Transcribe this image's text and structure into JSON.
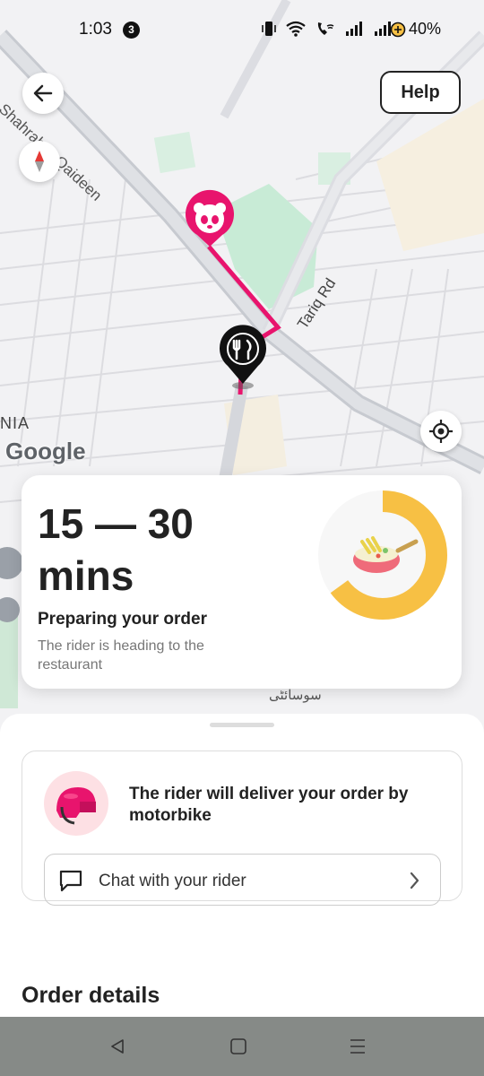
{
  "status_bar": {
    "time": "1:03",
    "notification_count": "3",
    "battery": "40%"
  },
  "map": {
    "street_1": "Shahrah-e-Qaideen",
    "street_2": "Tariq Rd",
    "area_label": "NIA",
    "urdu_label": "سوسائٹی",
    "google_logo": "Google",
    "route_color": "#e8146d",
    "restaurant_pin_color": "#111111"
  },
  "buttons": {
    "help_label": "Help"
  },
  "eta": {
    "range": "15 — 30",
    "unit": "mins",
    "status": "Preparing your order",
    "sub": "The rider is heading to the restaurant",
    "progress_color": "#f7c044"
  },
  "rider": {
    "message": "The rider will deliver your order by motorbike",
    "chat_label": "Chat with your rider"
  },
  "order": {
    "title": "Order details"
  },
  "colors": {
    "brand": "#e8146d",
    "accent_yellow": "#f7c044"
  }
}
